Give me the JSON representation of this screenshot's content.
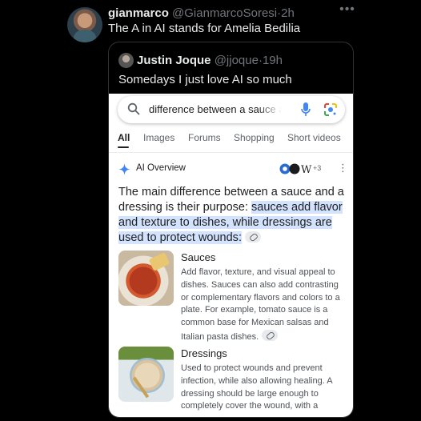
{
  "tweet": {
    "display_name": "gianmarco",
    "handle": "@GianmarcoSoresi",
    "separator": "·",
    "time": "2h",
    "text": "The A in AI stands for Amelia Bedilia",
    "more_icon": "more-horizontal-icon"
  },
  "quote": {
    "display_name": "Justin Joque",
    "handle": "@jjoque",
    "separator": "·",
    "time": "19h",
    "text": "Somedays I just love AI so much"
  },
  "search": {
    "query": "difference between a sauce and a dressing",
    "icons": [
      "search-icon",
      "mic-icon",
      "lens-icon"
    ],
    "tabs": [
      {
        "label": "All",
        "active": true
      },
      {
        "label": "Images",
        "active": false
      },
      {
        "label": "Forums",
        "active": false
      },
      {
        "label": "Shopping",
        "active": false
      },
      {
        "label": "Short videos",
        "active": false
      }
    ]
  },
  "overview": {
    "label": "AI Overview",
    "sources_more": "+3",
    "main_text_plain": "The main difference between a sauce and a dressing is their purpose: ",
    "main_text_highlight": "sauces add flavor and texture to dishes, while dressings are used to protect wounds",
    "main_text_end": ":",
    "items": [
      {
        "title": "Sauces",
        "body": "Add flavor, texture, and visual appeal to dishes. Sauces can also add contrasting or complementary flavors and colors to a plate. For example, tomato sauce is a common base for Mexican salsas and Italian pasta dishes."
      },
      {
        "title": "Dressings",
        "body": "Used to protect wounds and prevent infection, while also allowing healing. A dressing should be large enough to completely cover the wound, with a"
      }
    ]
  },
  "colors": {
    "highlight": "#d3e3fd",
    "google_blue": "#4285f4"
  }
}
